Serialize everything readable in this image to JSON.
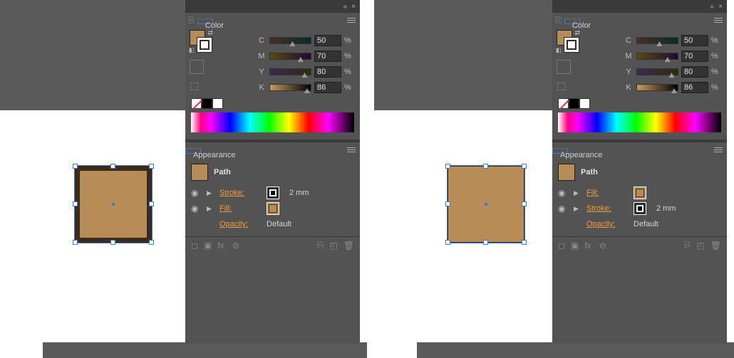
{
  "panel": {
    "color_tab": "Color",
    "appearance_tab": "Appearance",
    "channels": [
      "C",
      "M",
      "Y",
      "K"
    ],
    "values_left": {
      "C": "50",
      "M": "70",
      "Y": "80",
      "K": "86"
    },
    "values_right": {
      "C": "50",
      "M": "70",
      "Y": "80",
      "K": "86"
    },
    "pct": "%"
  },
  "appearance": {
    "path_label": "Path",
    "stroke_label": "Stroke:",
    "fill_label": "Fill:",
    "opacity_label": "Opacity:",
    "opacity_value": "Default",
    "stroke_value": "2 mm"
  },
  "colors": {
    "fill": "#b78c56",
    "stroke": "#2c2c2c"
  }
}
